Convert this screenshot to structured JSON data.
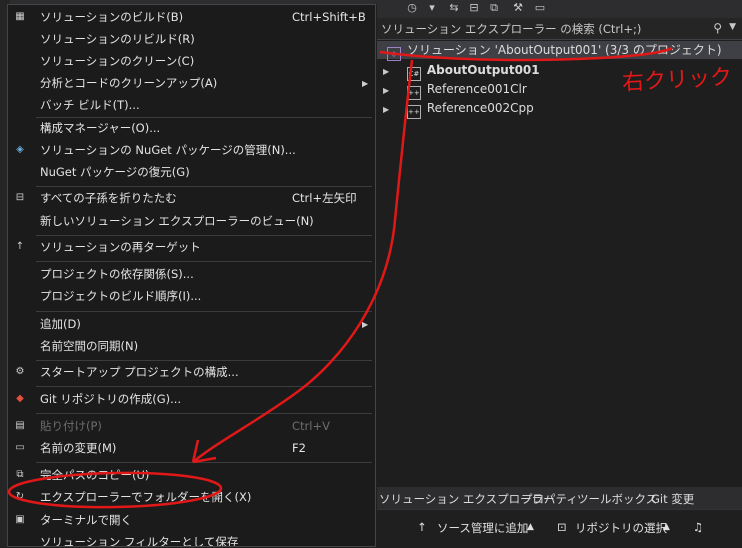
{
  "context_menu": {
    "items": [
      {
        "icon": "build-icon",
        "label": "ソリューションのビルド(B)",
        "shortcut": "Ctrl+Shift+B"
      },
      {
        "icon": "",
        "label": "ソリューションのリビルド(R)",
        "shortcut": ""
      },
      {
        "icon": "",
        "label": "ソリューションのクリーン(C)",
        "shortcut": ""
      },
      {
        "icon": "",
        "label": "分析とコードのクリーンアップ(A)",
        "shortcut": "",
        "submenu": true
      },
      {
        "icon": "",
        "label": "バッチ ビルド(T)...",
        "shortcut": ""
      },
      {
        "icon": "",
        "label": "構成マネージャー(O)...",
        "shortcut": ""
      },
      {
        "icon": "nuget-icon",
        "label": "ソリューションの NuGet パッケージの管理(N)...",
        "shortcut": ""
      },
      {
        "icon": "",
        "label": "NuGet パッケージの復元(G)",
        "shortcut": ""
      },
      {
        "icon": "collapse-icon",
        "label": "すべての子孫を折りたたむ",
        "shortcut": "Ctrl+左矢印"
      },
      {
        "icon": "",
        "label": "新しいソリューション エクスプローラーのビュー(N)",
        "shortcut": ""
      },
      {
        "icon": "retarget-icon",
        "label": "ソリューションの再ターゲット",
        "shortcut": ""
      },
      {
        "icon": "",
        "label": "プロジェクトの依存関係(S)...",
        "shortcut": ""
      },
      {
        "icon": "",
        "label": "プロジェクトのビルド順序(I)...",
        "shortcut": ""
      },
      {
        "icon": "",
        "label": "追加(D)",
        "shortcut": "",
        "submenu": true
      },
      {
        "icon": "",
        "label": "名前空間の同期(N)",
        "shortcut": ""
      },
      {
        "icon": "gear-icon",
        "label": "スタートアップ プロジェクトの構成...",
        "shortcut": ""
      },
      {
        "icon": "git-icon",
        "label": "Git リポジトリの作成(G)...",
        "shortcut": ""
      },
      {
        "icon": "paste-icon",
        "label": "貼り付け(P)",
        "shortcut": "Ctrl+V",
        "disabled": true
      },
      {
        "icon": "rename-icon",
        "label": "名前の変更(M)",
        "shortcut": "F2"
      },
      {
        "icon": "copy-icon",
        "label": "完全パスのコピー(U)",
        "shortcut": ""
      },
      {
        "icon": "open-folder-icon",
        "label": "エクスプローラーでフォルダーを開く(X)",
        "shortcut": ""
      },
      {
        "icon": "terminal-icon",
        "label": "ターミナルで開く",
        "shortcut": ""
      },
      {
        "icon": "",
        "label": "ソリューション フィルターとして保存",
        "shortcut": ""
      }
    ]
  },
  "solution_explorer": {
    "search_placeholder": "ソリューション エクスプローラー の検索 (Ctrl+;)",
    "tree": [
      {
        "label": "ソリューション 'AboutOutput001' (3/3 のプロジェクト)",
        "selected": true
      },
      {
        "label": "AboutOutput001",
        "bold": true
      },
      {
        "label": "Reference001Clr"
      },
      {
        "label": "Reference002Cpp"
      }
    ],
    "tabs": [
      "ソリューション エクスプローラー",
      "プロパティ",
      "ツールボックス",
      "Git 変更"
    ]
  },
  "statusbar": {
    "source_control": "ソース管理に追加",
    "repository": "リポジトリの選択"
  },
  "annotation": {
    "text": "右クリック",
    "color": "#e01818"
  }
}
